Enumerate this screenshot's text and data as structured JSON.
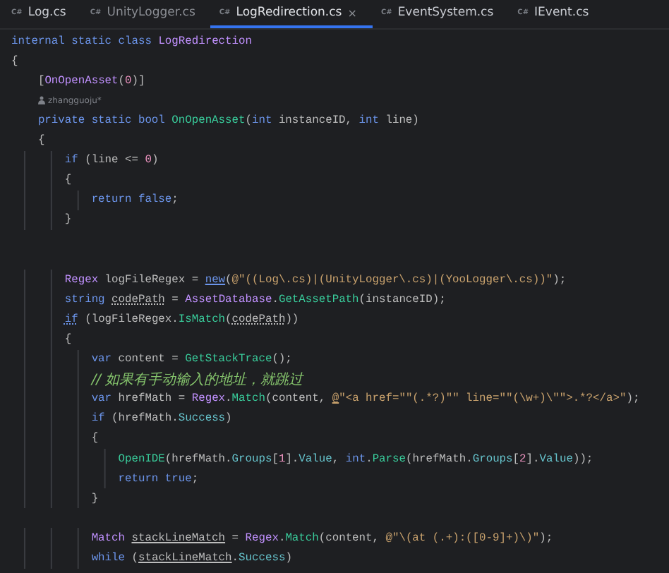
{
  "tabs": [
    {
      "badge": "C#",
      "label": "Log.cs",
      "selected": false,
      "dimmed": false
    },
    {
      "badge": "C#",
      "label": "UnityLogger.cs",
      "selected": false,
      "dimmed": true
    },
    {
      "badge": "C#",
      "label": "LogRedirection.cs",
      "selected": true,
      "dimmed": false,
      "close": "×"
    },
    {
      "badge": "C#",
      "label": "EventSystem.cs",
      "selected": false,
      "dimmed": false
    },
    {
      "badge": "C#",
      "label": "IEvent.cs",
      "selected": false,
      "dimmed": false
    }
  ],
  "lines": [
    {
      "kind": "code",
      "tokens": [
        {
          "text": "internal static class ",
          "kind": "keyword"
        },
        {
          "text": "LogRedirection",
          "kind": "type"
        }
      ]
    },
    {
      "kind": "code",
      "tokens": [
        {
          "text": "{",
          "kind": "plain"
        }
      ],
      "children": [
        {
          "kind": "code",
          "tokens": [
            {
              "text": "[",
              "kind": "plain"
            },
            {
              "text": "OnOpenAsset",
              "kind": "type"
            },
            {
              "text": "(",
              "kind": "plain"
            },
            {
              "text": "0",
              "kind": "number"
            },
            {
              "text": ")]",
              "kind": "plain"
            }
          ]
        },
        {
          "kind": "codelens",
          "author": "zhangguoju*"
        },
        {
          "kind": "code",
          "tokens": [
            {
              "text": "private static bool ",
              "kind": "keyword"
            },
            {
              "text": "OnOpenAsset",
              "kind": "method"
            },
            {
              "text": "(",
              "kind": "plain"
            },
            {
              "text": "int ",
              "kind": "keyword"
            },
            {
              "text": "instanceID, ",
              "kind": "plain"
            },
            {
              "text": "int ",
              "kind": "keyword"
            },
            {
              "text": "line)",
              "kind": "plain"
            }
          ]
        },
        {
          "kind": "code",
          "tokens": [
            {
              "text": "{",
              "kind": "plain"
            }
          ],
          "children": [
            {
              "kind": "code",
              "tokens": [
                {
                  "text": "if ",
                  "kind": "keyword"
                },
                {
                  "text": "(line <= ",
                  "kind": "plain"
                },
                {
                  "text": "0",
                  "kind": "number"
                },
                {
                  "text": ")",
                  "kind": "plain"
                }
              ]
            },
            {
              "kind": "code",
              "tokens": [
                {
                  "text": "{",
                  "kind": "plain"
                }
              ],
              "children": [
                {
                  "kind": "code",
                  "tokens": [
                    {
                      "text": "return false",
                      "kind": "keyword"
                    },
                    {
                      "text": ";",
                      "kind": "plain"
                    }
                  ]
                }
              ]
            },
            {
              "kind": "code",
              "tokens": [
                {
                  "text": "}",
                  "kind": "plain"
                }
              ]
            },
            {
              "kind": "blank"
            },
            {
              "kind": "blank"
            },
            {
              "kind": "code",
              "tokens": [
                {
                  "text": "Regex",
                  "kind": "type"
                },
                {
                  "text": " logFileRegex = ",
                  "kind": "plain"
                },
                {
                  "text": "new",
                  "kind": "keyword",
                  "underline": true
                },
                {
                  "text": "(",
                  "kind": "plain"
                },
                {
                  "text": "@\"((Log\\.cs)|(UnityLogger\\.cs)|(YooLogger\\.cs))\"",
                  "kind": "string"
                },
                {
                  "text": ");",
                  "kind": "plain"
                }
              ]
            },
            {
              "kind": "code",
              "tokens": [
                {
                  "text": "string ",
                  "kind": "keyword"
                },
                {
                  "text": "codePath",
                  "kind": "plain",
                  "dotted_underline": true
                },
                {
                  "text": " = ",
                  "kind": "plain"
                },
                {
                  "text": "AssetDatabase",
                  "kind": "type"
                },
                {
                  "text": ".",
                  "kind": "plain"
                },
                {
                  "text": "GetAssetPath",
                  "kind": "method"
                },
                {
                  "text": "(instanceID);",
                  "kind": "plain"
                }
              ]
            },
            {
              "kind": "code",
              "tokens": [
                {
                  "text": "if",
                  "kind": "keyword",
                  "dotted_underline": true
                },
                {
                  "text": " (logFileRegex.",
                  "kind": "plain"
                },
                {
                  "text": "IsMatch",
                  "kind": "method"
                },
                {
                  "text": "(",
                  "kind": "plain"
                },
                {
                  "text": "codePath",
                  "kind": "plain",
                  "dotted_underline": true
                },
                {
                  "text": "))",
                  "kind": "plain"
                }
              ]
            },
            {
              "kind": "code",
              "tokens": [
                {
                  "text": "{",
                  "kind": "plain"
                }
              ],
              "children": [
                {
                  "kind": "code",
                  "tokens": [
                    {
                      "text": "var ",
                      "kind": "keyword"
                    },
                    {
                      "text": "content = ",
                      "kind": "plain"
                    },
                    {
                      "text": "GetStackTrace",
                      "kind": "method"
                    },
                    {
                      "text": "();",
                      "kind": "plain"
                    }
                  ]
                },
                {
                  "kind": "code",
                  "tokens": [
                    {
                      "text": "// 如果有手动输入的地址，就跳过",
                      "kind": "comment"
                    }
                  ]
                },
                {
                  "kind": "code",
                  "tokens": [
                    {
                      "text": "var ",
                      "kind": "keyword"
                    },
                    {
                      "text": "hrefMath = ",
                      "kind": "plain"
                    },
                    {
                      "text": "Regex",
                      "kind": "type"
                    },
                    {
                      "text": ".",
                      "kind": "plain"
                    },
                    {
                      "text": "Match",
                      "kind": "method"
                    },
                    {
                      "text": "(content, ",
                      "kind": "plain"
                    },
                    {
                      "text": "@",
                      "kind": "string",
                      "underline": true
                    },
                    {
                      "text": "\"<a href=\"\"(.*?)\"\" line=\"\"(\\w+)\\\"\">.*?</a>\"",
                      "kind": "string"
                    },
                    {
                      "text": ");",
                      "kind": "plain"
                    }
                  ]
                },
                {
                  "kind": "code",
                  "tokens": [
                    {
                      "text": "if ",
                      "kind": "keyword"
                    },
                    {
                      "text": "(hrefMath.",
                      "kind": "plain"
                    },
                    {
                      "text": "Success",
                      "kind": "property"
                    },
                    {
                      "text": ")",
                      "kind": "plain"
                    }
                  ]
                },
                {
                  "kind": "code",
                  "tokens": [
                    {
                      "text": "{",
                      "kind": "plain"
                    }
                  ],
                  "children": [
                    {
                      "kind": "code",
                      "tokens": [
                        {
                          "text": "OpenIDE",
                          "kind": "method"
                        },
                        {
                          "text": "(hrefMath.",
                          "kind": "plain"
                        },
                        {
                          "text": "Groups",
                          "kind": "property"
                        },
                        {
                          "text": "[",
                          "kind": "plain"
                        },
                        {
                          "text": "1",
                          "kind": "number"
                        },
                        {
                          "text": "].",
                          "kind": "plain"
                        },
                        {
                          "text": "Value",
                          "kind": "property"
                        },
                        {
                          "text": ", ",
                          "kind": "plain"
                        },
                        {
                          "text": "int",
                          "kind": "keyword"
                        },
                        {
                          "text": ".",
                          "kind": "plain"
                        },
                        {
                          "text": "Parse",
                          "kind": "method"
                        },
                        {
                          "text": "(hrefMath.",
                          "kind": "plain"
                        },
                        {
                          "text": "Groups",
                          "kind": "property"
                        },
                        {
                          "text": "[",
                          "kind": "plain"
                        },
                        {
                          "text": "2",
                          "kind": "number"
                        },
                        {
                          "text": "].",
                          "kind": "plain"
                        },
                        {
                          "text": "Value",
                          "kind": "property"
                        },
                        {
                          "text": "));",
                          "kind": "plain"
                        }
                      ]
                    },
                    {
                      "kind": "code",
                      "tokens": [
                        {
                          "text": "return true",
                          "kind": "keyword"
                        },
                        {
                          "text": ";",
                          "kind": "plain"
                        }
                      ]
                    }
                  ]
                },
                {
                  "kind": "code",
                  "tokens": [
                    {
                      "text": "}",
                      "kind": "plain"
                    }
                  ]
                },
                {
                  "kind": "blank"
                },
                {
                  "kind": "code",
                  "tokens": [
                    {
                      "text": "Match ",
                      "kind": "type"
                    },
                    {
                      "text": "stackLineMatch",
                      "kind": "plain",
                      "underline": true
                    },
                    {
                      "text": " = ",
                      "kind": "plain"
                    },
                    {
                      "text": "Regex",
                      "kind": "type"
                    },
                    {
                      "text": ".",
                      "kind": "plain"
                    },
                    {
                      "text": "Match",
                      "kind": "method"
                    },
                    {
                      "text": "(content, ",
                      "kind": "plain"
                    },
                    {
                      "text": "@\"\\(at (.+):([0-9]+)\\)\"",
                      "kind": "string"
                    },
                    {
                      "text": ");",
                      "kind": "plain"
                    }
                  ]
                },
                {
                  "kind": "code",
                  "tokens": [
                    {
                      "text": "while ",
                      "kind": "keyword"
                    },
                    {
                      "text": "(",
                      "kind": "plain"
                    },
                    {
                      "text": "stackLineMatch",
                      "kind": "plain",
                      "underline": true
                    },
                    {
                      "text": ".",
                      "kind": "plain"
                    },
                    {
                      "text": "Success",
                      "kind": "property"
                    },
                    {
                      "text": ")",
                      "kind": "plain"
                    }
                  ]
                }
              ]
            }
          ]
        }
      ]
    }
  ]
}
